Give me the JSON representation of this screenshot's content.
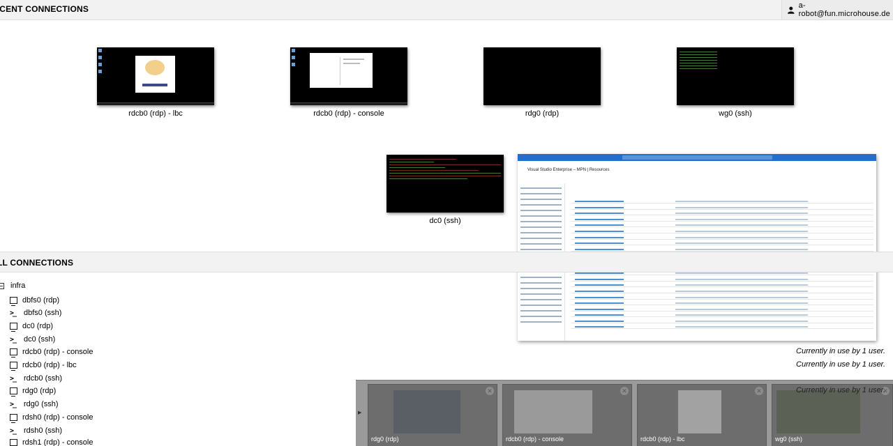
{
  "header": {
    "recent_title": "ECENT CONNECTIONS",
    "user": "a-robot@fun.microhouse.de",
    "user_icon": "user-icon"
  },
  "recent": [
    {
      "caption": "rdcb0 (rdp) - lbc"
    },
    {
      "caption": "rdcb0 (rdp) - console"
    },
    {
      "caption": "rdg0 (rdp)"
    },
    {
      "caption": "wg0 (ssh)"
    },
    {
      "caption": "dc0 (ssh)"
    }
  ],
  "azure_preview": {
    "title": "Visual Studio Enterprise – MPN | Resources"
  },
  "all_connections": {
    "title": "LL CONNECTIONS",
    "group": "infra",
    "items": [
      {
        "label": "dbfs0 (rdp)",
        "icon": "rdp-icon"
      },
      {
        "label": "dbfs0 (ssh)",
        "icon": "ssh-icon"
      },
      {
        "label": "dc0 (rdp)",
        "icon": "rdp-icon"
      },
      {
        "label": "dc0 (ssh)",
        "icon": "ssh-icon"
      },
      {
        "label": "rdcb0 (rdp) - console",
        "icon": "rdp-icon"
      },
      {
        "label": "rdcb0 (rdp) - lbc",
        "icon": "rdp-icon"
      },
      {
        "label": "rdcb0 (ssh)",
        "icon": "ssh-icon"
      },
      {
        "label": "rdg0 (rdp)",
        "icon": "rdp-icon"
      },
      {
        "label": "rdg0 (ssh)",
        "icon": "ssh-icon"
      },
      {
        "label": "rdsh0 (rdp) - console",
        "icon": "rdp-icon"
      },
      {
        "label": "rdsh0 (ssh)",
        "icon": "ssh-icon"
      },
      {
        "label": "rdsh1 (rdp) - console",
        "icon": "rdp-icon"
      }
    ]
  },
  "in_use": [
    "Currently in use by 1 user.",
    "Currently in use by 1 user.",
    "Currently in use by 1 user."
  ],
  "active_sessions": [
    {
      "label": "rdg0 (rdp)"
    },
    {
      "label": "rdcb0 (rdp) - console"
    },
    {
      "label": "rdcb0 (rdp) - lbc"
    },
    {
      "label": "wg0 (ssh)"
    }
  ]
}
